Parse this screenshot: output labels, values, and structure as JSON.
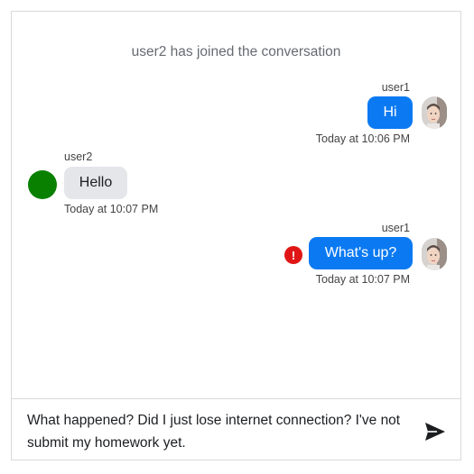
{
  "system_message": "user2 has joined the conversation",
  "messages": [
    {
      "sender": "user1",
      "text": "Hi",
      "time": "Today at 10:06 PM"
    },
    {
      "sender": "user2",
      "text": "Hello",
      "time": "Today at 10:07 PM"
    },
    {
      "sender": "user1",
      "text": "What's up?",
      "time": "Today at 10:07 PM",
      "status_icon": "error-icon"
    }
  ],
  "composer": {
    "text": "What happened? Did I just lose internet connection? I've not submit my homework yet.",
    "send_icon": "send-icon"
  },
  "colors": {
    "outgoing_bubble": "#0b7af2",
    "incoming_bubble": "#e4e6ea",
    "user2_avatar": "#0a8000",
    "error": "#e01616"
  }
}
